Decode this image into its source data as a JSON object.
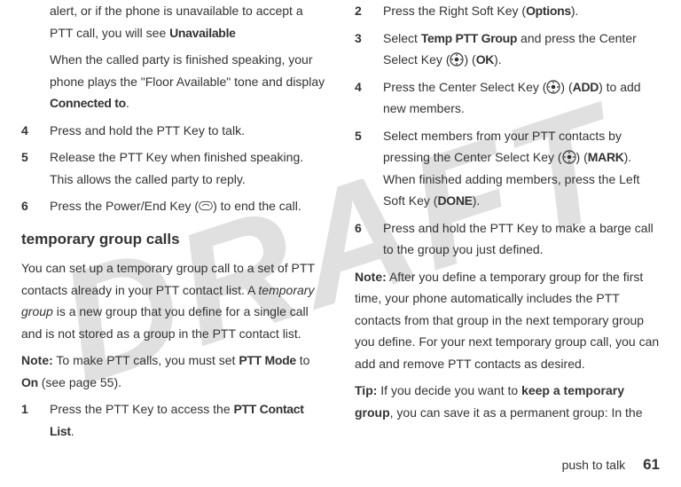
{
  "watermark": "DRAFT",
  "left": {
    "p1a": "alert, or if the phone is unavailable to accept a PTT call, you will see ",
    "p1b_cond": "Unavailable",
    "p2a": "When the called party is finished speaking, your phone plays the \"Floor Available\" tone and display ",
    "p2b_cond": "Connected to",
    "p2c": ".",
    "step4": "Press and hold the PTT Key to talk.",
    "step5": "Release the PTT Key when finished speaking. This allows the called party to reply.",
    "step6a": "Press the Power/End Key (",
    "step6b": ") to end the call.",
    "section_heading": "temporary group calls",
    "p3a": "You can set up a temporary group call to a set of PTT contacts already in your PTT contact list. A ",
    "p3b_italic": "temporary group",
    "p3c": " is a new group that you define for a single call and is not stored as a group in the PTT contact list.",
    "note_label": "Note:",
    "note_a": " To make PTT calls, you must set ",
    "note_b_cond": "PTT Mode",
    "note_c": " to ",
    "note_d_cond": "On",
    "note_e": " (see page 55).",
    "step1a": "Press the PTT Key to access the ",
    "step1b_cond": "PTT Contact List",
    "step1c": "."
  },
  "right": {
    "step2a": "Press the Right Soft Key (",
    "step2b_cond": "Options",
    "step2c": ").",
    "step3a": "Select ",
    "step3b_cond": "Temp PTT Group",
    "step3c": " and press the Center Select Key (",
    "step3d": ") (",
    "step3e_cond": "OK",
    "step3f": ").",
    "step4a": "Press the Center Select Key (",
    "step4b": ") (",
    "step4c_cond": "ADD",
    "step4d": ") to add new members.",
    "step5a": "Select members from your PTT contacts by pressing the Center Select Key (",
    "step5b": ") (",
    "step5c_cond": "MARK",
    "step5d": "). When finished adding members, press the Left Soft Key (",
    "step5e_cond": "DONE",
    "step5f": ").",
    "step6": "Press and hold the PTT Key to make a barge call to the group you just defined.",
    "note2_label": "Note:",
    "note2_body": " After you define a temporary group for the first time, your phone automatically includes the PTT contacts from that group in the next temporary group you define. For your next temporary group call, you can add and remove PTT contacts as desired.",
    "tip_label": "Tip:",
    "tip_a": " If you decide you want to ",
    "tip_b_bold": "keep a temporary group",
    "tip_c": ", you can save it as a permanent group: In the"
  },
  "footer": {
    "section": "push to talk",
    "page": "61"
  }
}
